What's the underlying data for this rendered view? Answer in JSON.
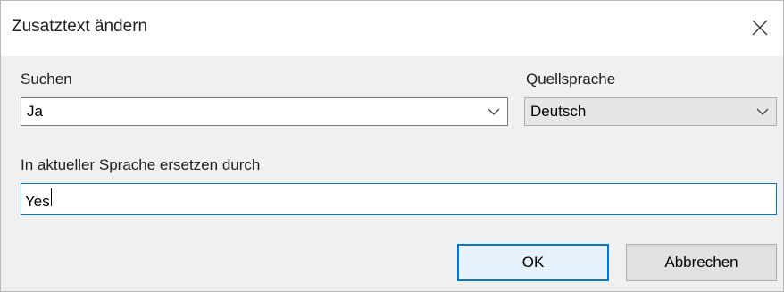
{
  "dialog": {
    "title": "Zusatztext ändern",
    "close_icon": "close-icon"
  },
  "search": {
    "label": "Suchen",
    "value": "Ja",
    "dropdown_icon": "chevron-down-icon"
  },
  "source_language": {
    "label": "Quellsprache",
    "value": "Deutsch",
    "dropdown_icon": "chevron-down-icon"
  },
  "replace": {
    "label": "In aktueller Sprache ersetzen durch",
    "value": "Yes"
  },
  "buttons": {
    "ok_label": "OK",
    "cancel_label": "Abbrechen"
  },
  "colors": {
    "focus_accent": "#0078d7",
    "client_background": "#f0f0f0"
  }
}
